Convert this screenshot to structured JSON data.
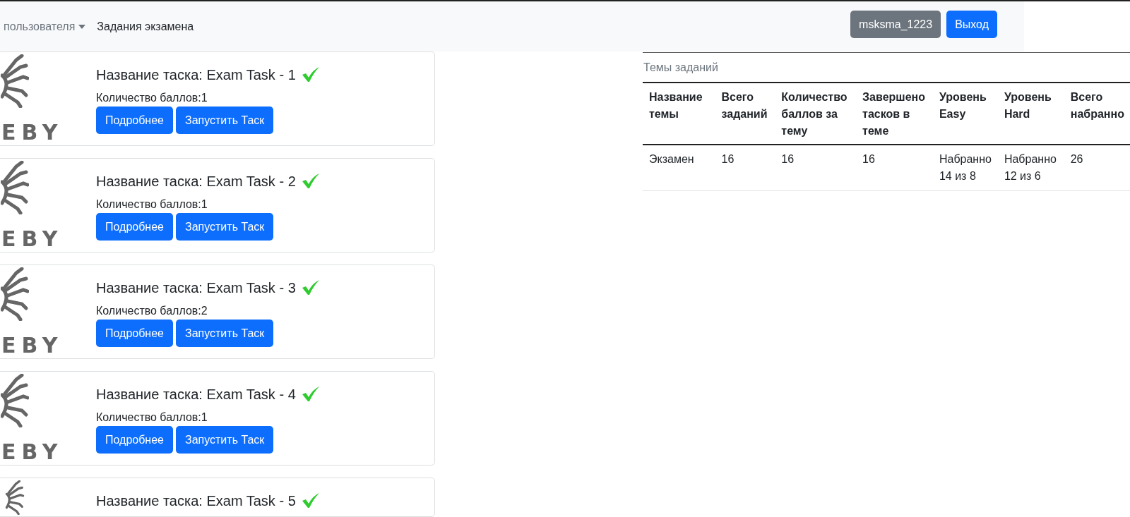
{
  "navbar": {
    "items": [
      {
        "label": "пользователя",
        "kind": "dropdown"
      },
      {
        "label": "Задания экзамена",
        "kind": "link"
      }
    ],
    "user_button": "msksma_1223",
    "logout_button": "Выход"
  },
  "tasks": [
    {
      "logo_text": "EBY",
      "title": "Название таска: Exam Task - 1",
      "completed": true,
      "points": "Количество баллов:1",
      "buttons": [
        "Подробнее",
        "Запустить Таск"
      ]
    },
    {
      "logo_text": "EBY",
      "title": "Название таска: Exam Task - 2",
      "completed": true,
      "points": "Количество баллов:1",
      "buttons": [
        "Подробнее",
        "Запустить Таск"
      ]
    },
    {
      "logo_text": "EBY",
      "title": "Название таска: Exam Task - 3",
      "completed": true,
      "points": "Количество баллов:2",
      "buttons": [
        "Подробнее",
        "Запустить Таск"
      ]
    },
    {
      "logo_text": "EBY",
      "title": "Название таска: Exam Task - 4",
      "completed": true,
      "points": "Количество баллов:1",
      "buttons": [
        "Подробнее",
        "Запустить Таск"
      ]
    },
    {
      "title": "Название таска: Exam Task - 5",
      "completed": true
    }
  ],
  "topics": {
    "caption": "Темы заданий",
    "columns": [
      "Название темы",
      "Всего заданий",
      "Количество баллов за тему",
      "Завершено тасков в теме",
      "Уровень Easy",
      "Уровень Hard",
      "Всего набранно"
    ],
    "rows": [
      [
        "Экзамен",
        "16",
        "16",
        "16",
        "Набранно 14 из 8",
        "Набранно 12 из 6",
        "26"
      ]
    ]
  }
}
